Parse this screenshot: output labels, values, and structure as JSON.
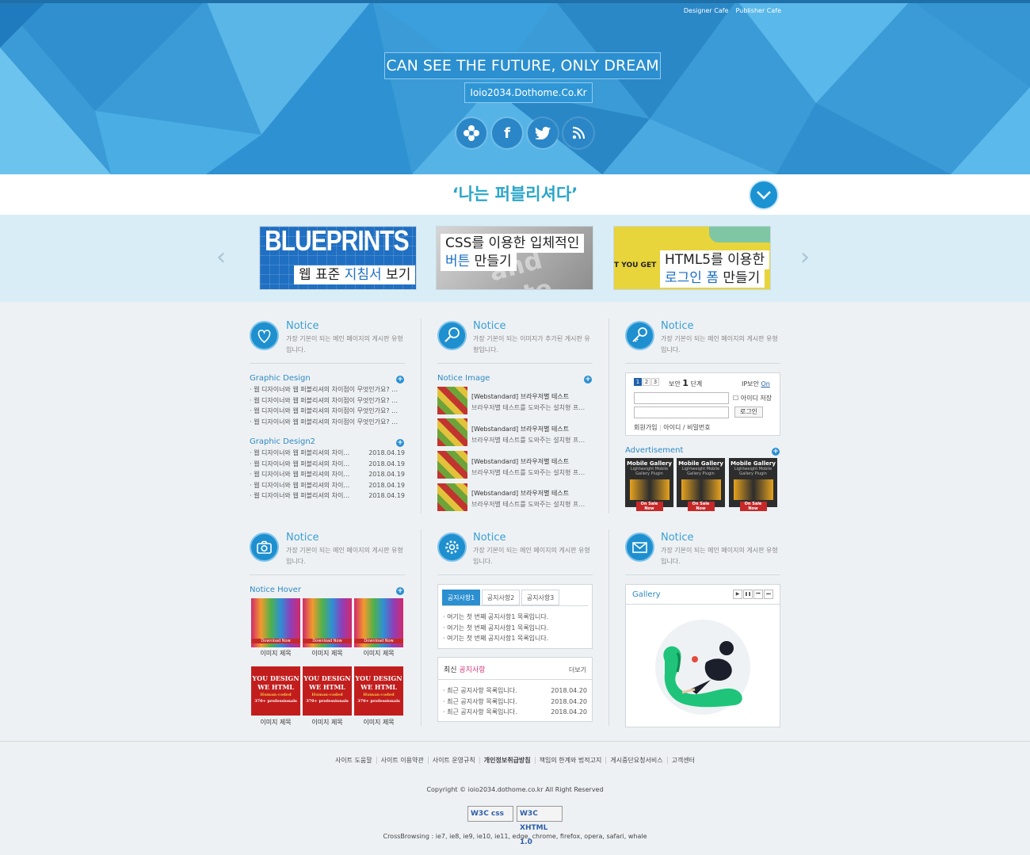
{
  "header": {
    "links": [
      "Designer Cafe",
      "Publisher Cafe"
    ],
    "title": "CAN SEE THE FUTURE, ONLY DREAM",
    "subtitle": "Ioio2034.Dothome.Co.Kr",
    "social": [
      "flower-icon",
      "facebook-icon",
      "twitter-icon",
      "rss-icon"
    ]
  },
  "band": {
    "title": "‘나는 퍼블리셔다’"
  },
  "slider": {
    "slides": [
      {
        "big": "BLUEPRINTS",
        "label_a": "웹 표준 ",
        "label_b": "지침서",
        "label_c": " 보기"
      },
      {
        "line1": "CSS를 이용한 입체적인",
        "line2_a": "버튼",
        "line2_b": " 만들기"
      },
      {
        "side": "T YOU GET",
        "line1": "HTML5를 이용한",
        "line2_a": "로그인 폼",
        "line2_b": " 만들기"
      }
    ]
  },
  "notice": {
    "title": "Notice",
    "desc1": "가장 기본이 되는 메인 페이지의 게시판 유형입니다.",
    "desc2": "가장 기본이 되는 이미지가 추가된 게시판 유형입니다."
  },
  "col1": {
    "sec1": "Graphic Design",
    "items1": [
      "웹 디자이너와 웹 퍼블리셔의 차이점이 무엇인가요? …",
      "웹 디자이너와 웹 퍼블리셔의 차이점이 무엇인가요? …",
      "웹 디자이너와 웹 퍼블리셔의 차이점이 무엇인가요? …",
      "웹 디자이너와 웹 퍼블리셔의 차이점이 무엇인가요? …"
    ],
    "sec2": "Graphic Design2",
    "items2": [
      {
        "t": "웹 디자이너와 웹 퍼블리셔의 차이…",
        "d": "2018.04.19"
      },
      {
        "t": "웹 디자이너와 웹 퍼블리셔의 차이…",
        "d": "2018.04.19"
      },
      {
        "t": "웹 디자이너와 웹 퍼블리셔의 차이…",
        "d": "2018.04.19"
      },
      {
        "t": "웹 디자이너와 웹 퍼블리셔의 차이…",
        "d": "2018.04.19"
      },
      {
        "t": "웹 디자이너와 웹 퍼블리셔의 차이…",
        "d": "2018.04.19"
      }
    ],
    "sec3": "Notice Hover",
    "img_caption": "이미지 제목",
    "thumb_banner": "Download Now",
    "you_design": [
      "YOU DESIGN",
      "WE HTML",
      "Human-coded",
      "370+ professionals"
    ]
  },
  "col2": {
    "sec1": "Notice Image",
    "items": [
      {
        "t": "[Webstandard] 브라우저별 테스트",
        "d": "브라우저별 테스트를 도와주는 설치형 프…"
      },
      {
        "t": "[Webstandard] 브라우저별 테스트",
        "d": "브라우저별 테스트를 도와주는 설치형 프…"
      },
      {
        "t": "[Webstandard] 브라우저별 테스트",
        "d": "브라우저별 테스트를 도와주는 설치형 프…"
      },
      {
        "t": "[Webstandard] 브라우저별 테스트",
        "d": "브라우저별 테스트를 도와주는 설치형 프…"
      }
    ],
    "tabs": [
      "공지사항1",
      "공지사항2",
      "공지사항3"
    ],
    "tab_items": [
      "여기는 첫 번째 공지사항1 목록입니다.",
      "여기는 첫 번째 공지사항1 목록입니다.",
      "여기는 첫 번째 공지사항1 목록입니다."
    ],
    "recent_a": "최신 ",
    "recent_b": "공지사항",
    "more": "더보기",
    "recent_items": [
      {
        "t": "최근 공지사항 목록입니다.",
        "d": "2018.04.20"
      },
      {
        "t": "최근 공지사항 목록입니다.",
        "d": "2018.04.20"
      },
      {
        "t": "최근 공지사항 목록입니다.",
        "d": "2018.04.20"
      }
    ]
  },
  "col3": {
    "login": {
      "steps": [
        "1",
        "2",
        "3"
      ],
      "level_a": "보안",
      "level_num": "1",
      "level_b": "단계",
      "ip_label": "IP보안",
      "ip_state": "On",
      "save_id": "아이디 저장",
      "login_btn": "로그인",
      "join": "회원가입",
      "find": "아이디 / 비밀번호"
    },
    "ad_title": "Advertisement",
    "ad_label": "Mobile Gallery",
    "ad_sub": "Lightweight Mobile Gallery Plugin",
    "ad_sale": "On Sale Now",
    "gallery_title": "Gallery",
    "gallery_controls": [
      "▶",
      "❚❚",
      "⏮",
      "⏭"
    ]
  },
  "footer": {
    "links": [
      "사이트 도움말",
      "사이트 이용약관",
      "사이트 운영규칙",
      "개인정보취급방침",
      "책임의 한계와 법적고지",
      "게시중단요청서비스",
      "고객센터"
    ],
    "copyright": "Copyright © ioio2034.dothome.co.kr All Right Reserved",
    "badge_css": "W3C css",
    "badge_xhtml": "W3C XHTML 1.0",
    "cross": "CrossBrowsing : ie7, ie8, ie9, ie10, ie11, edge, chrome, firefox, opera, safari, whale"
  },
  "colors": {
    "accent": "#1e8fcf",
    "header": "#3a9bd6",
    "band_title": "#2aa6c9"
  }
}
